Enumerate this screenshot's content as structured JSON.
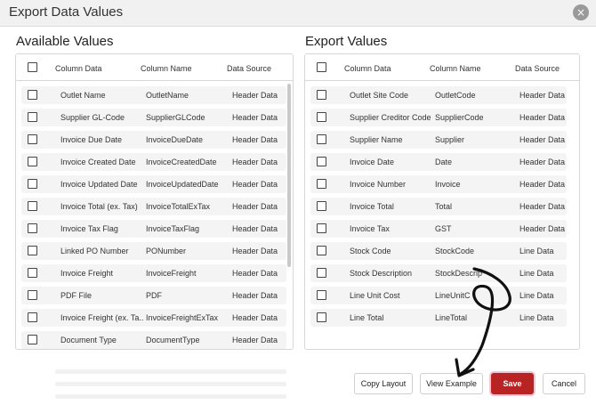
{
  "dialog": {
    "title": "Export Data Values",
    "close_label": "×"
  },
  "available": {
    "title": "Available Values",
    "headers": {
      "column_data": "Column Data",
      "column_name": "Column Name",
      "data_source": "Data Source"
    },
    "rows": [
      {
        "data": "Outlet Name",
        "name": "OutletName",
        "source": "Header Data"
      },
      {
        "data": "Supplier GL-Code",
        "name": "SupplierGLCode",
        "source": "Header Data"
      },
      {
        "data": "Invoice Due Date",
        "name": "InvoiceDueDate",
        "source": "Header Data"
      },
      {
        "data": "Invoice Created Date",
        "name": "InvoiceCreatedDate",
        "source": "Header Data"
      },
      {
        "data": "Invoice Updated Date",
        "name": "InvoiceUpdatedDate",
        "source": "Header Data"
      },
      {
        "data": "Invoice Total (ex. Tax)",
        "name": "InvoiceTotalExTax",
        "source": "Header Data"
      },
      {
        "data": "Invoice Tax Flag",
        "name": "InvoiceTaxFlag",
        "source": "Header Data"
      },
      {
        "data": "Linked PO Number",
        "name": "PONumber",
        "source": "Header Data"
      },
      {
        "data": "Invoice Freight",
        "name": "InvoiceFreight",
        "source": "Header Data"
      },
      {
        "data": "PDF File",
        "name": "PDF",
        "source": "Header Data"
      },
      {
        "data": "Invoice Freight (ex. Ta...",
        "name": "InvoiceFreightExTax",
        "source": "Header Data"
      },
      {
        "data": "Document Type",
        "name": "DocumentType",
        "source": "Header Data"
      }
    ]
  },
  "export": {
    "title": "Export Values",
    "headers": {
      "column_data": "Column Data",
      "column_name": "Column Name",
      "data_source": "Data Source"
    },
    "rows": [
      {
        "data": "Outlet Site Code",
        "name": "OutletCode",
        "source": "Header Data"
      },
      {
        "data": "Supplier Creditor Code",
        "name": "SupplierCode",
        "source": "Header Data"
      },
      {
        "data": "Supplier Name",
        "name": "Supplier",
        "source": "Header Data"
      },
      {
        "data": "Invoice Date",
        "name": "Date",
        "source": "Header Data"
      },
      {
        "data": "Invoice Number",
        "name": "Invoice",
        "source": "Header Data"
      },
      {
        "data": "Invoice Total",
        "name": "Total",
        "source": "Header Data"
      },
      {
        "data": "Invoice Tax",
        "name": "GST",
        "source": "Header Data"
      },
      {
        "data": "Stock Code",
        "name": "StockCode",
        "source": "Line Data"
      },
      {
        "data": "Stock Description",
        "name": "StockDescrip",
        "source": "Line Data"
      },
      {
        "data": "Line Unit Cost",
        "name": "LineUnitC",
        "source": "Line Data"
      },
      {
        "data": "Line Total",
        "name": "LineTotal",
        "source": "Line Data"
      }
    ]
  },
  "buttons": {
    "copy_layout": "Copy Layout",
    "view_example": "View Example",
    "save": "Save",
    "cancel": "Cancel"
  },
  "colors": {
    "save": "#b82323",
    "titlebar": "#f1f1f1",
    "row": "#f4f4f4"
  }
}
